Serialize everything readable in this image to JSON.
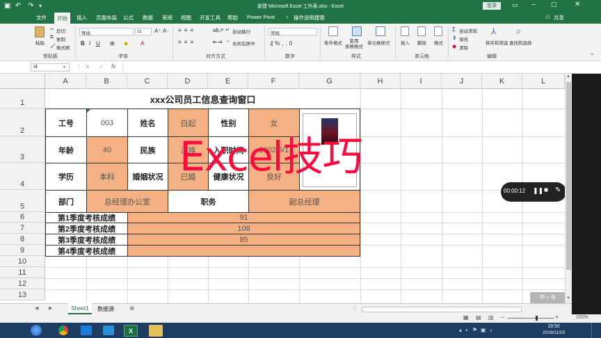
{
  "window": {
    "title": "新建 Microsoft Excel 工作表.xlsx - Excel",
    "login": "登录",
    "share": "共享"
  },
  "ribbon_tabs": [
    "文件",
    "开始",
    "插入",
    "页面布局",
    "公式",
    "数据",
    "审阅",
    "视图",
    "开发工具",
    "帮助",
    "Power Pivot",
    "操作说明搜索"
  ],
  "ribbon": {
    "clipboard": {
      "paste": "粘贴",
      "cut": "剪切",
      "copy": "复制",
      "painter": "格式刷",
      "label": "剪贴板"
    },
    "font": {
      "name": "等线",
      "size": "11",
      "label": "字体"
    },
    "alignment": {
      "wrap": "自动换行",
      "merge": "合并后居中",
      "label": "对齐方式"
    },
    "number": {
      "format": "常规",
      "label": "数字"
    },
    "styles": {
      "cond": "条件格式",
      "table": "套用\n表格格式",
      "cell": "单元格样式",
      "label": "样式"
    },
    "cells": {
      "insert": "插入",
      "delete": "删除",
      "format": "格式",
      "label": "单元格"
    },
    "editing": {
      "autosum": "自动求和",
      "fill": "填充",
      "clear": "清除",
      "sort": "排序和筛选",
      "find": "查找和选择",
      "label": "编辑"
    }
  },
  "formula_bar": {
    "name_box": "I4",
    "fx": "fx",
    "value": ""
  },
  "columns": [
    "A",
    "B",
    "C",
    "D",
    "E",
    "F",
    "G",
    "H",
    "I",
    "J",
    "K",
    "L"
  ],
  "rows": [
    "1",
    "2",
    "3",
    "4",
    "5",
    "6",
    "7",
    "8",
    "9",
    "10",
    "11",
    "12",
    "13"
  ],
  "sheet": {
    "title": "xxx公司员工信息查询窗口",
    "r2": {
      "l1": "工号",
      "v1": "003",
      "l2": "姓名",
      "v2": "白起",
      "l3": "性别",
      "v3": "女"
    },
    "r3": {
      "l1": "年龄",
      "v1": "40",
      "l2": "民族",
      "v2": "汉族",
      "l3": "入职时间",
      "v3": "2002/5/1"
    },
    "r4": {
      "l1": "学历",
      "v1": "本科",
      "l2": "婚姻状况",
      "v2": "已婚",
      "l3": "健康状况",
      "v3": "良好"
    },
    "r5": {
      "l1": "部门",
      "v1": "总经理办公室",
      "l2": "职务",
      "v2": "副总经理"
    },
    "scores": [
      {
        "label": "第1季度考核成绩",
        "value": "91"
      },
      {
        "label": "第2季度考核成绩",
        "value": "108"
      },
      {
        "label": "第3季度考核成绩",
        "value": "85"
      },
      {
        "label": "第4季度考核成绩",
        "value": ""
      }
    ]
  },
  "overlay": {
    "text": "Excel技巧"
  },
  "recorder": {
    "time": "00:00:12"
  },
  "sheet_tabs": [
    "Sheet1",
    "数据源"
  ],
  "status": {
    "zoom": "150%"
  },
  "clock": {
    "time": "19:50",
    "date": "2019/11/19"
  },
  "colors": {
    "excel_green": "#217346",
    "orange_fill": "#f4b183",
    "overlay_red": "#ff0a3c"
  }
}
